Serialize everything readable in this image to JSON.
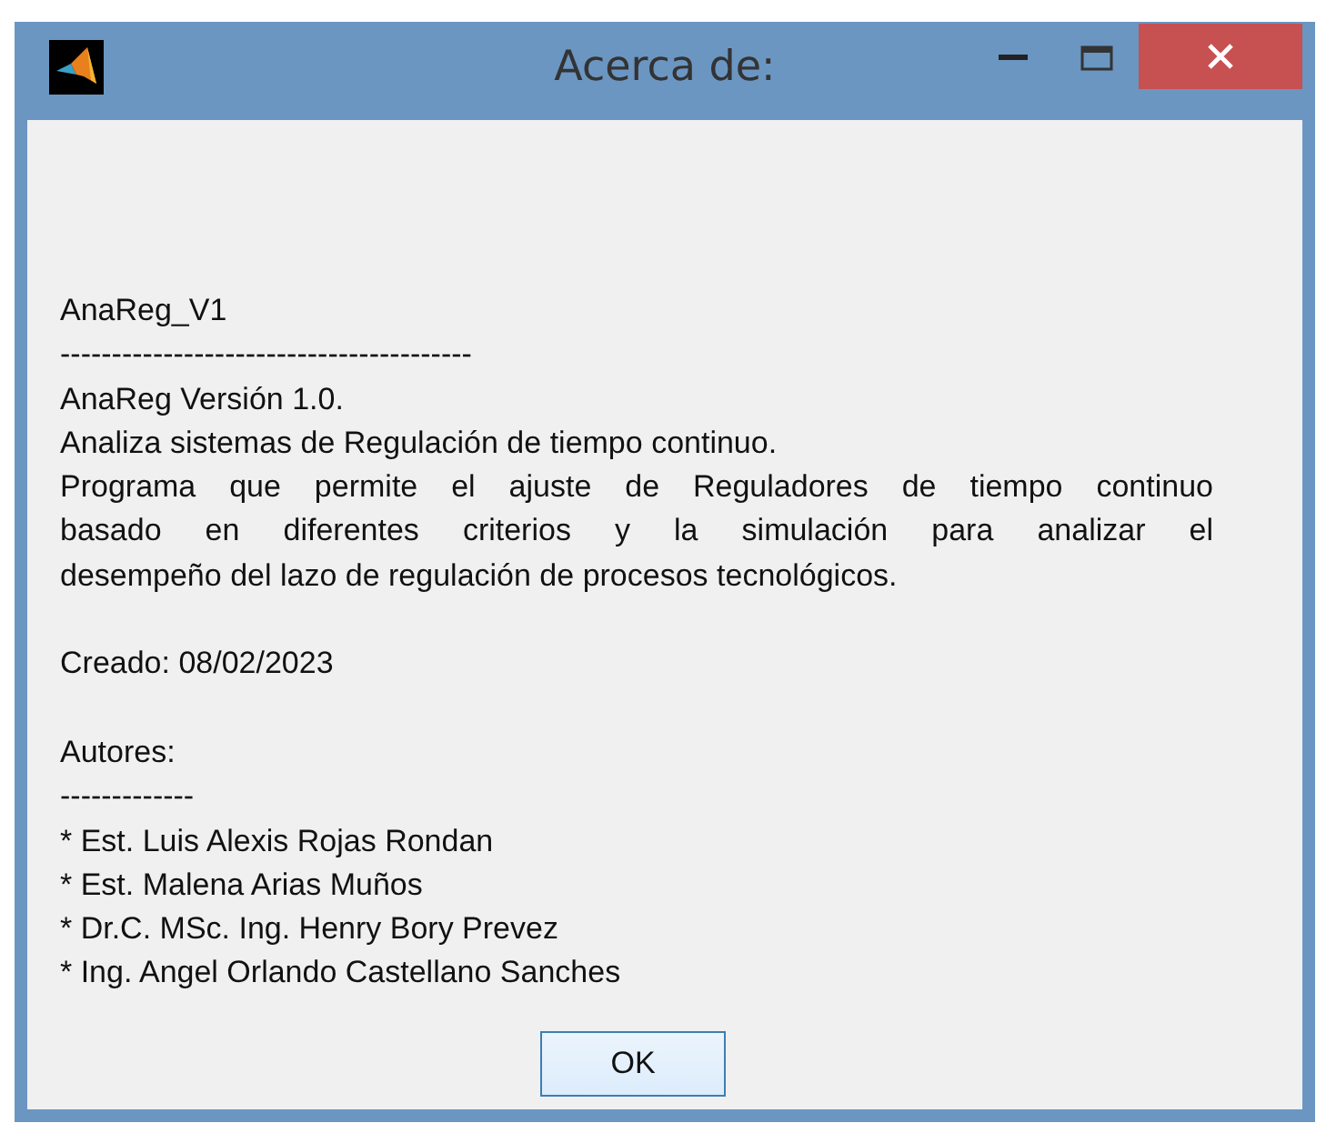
{
  "window": {
    "title": "Acerca de:"
  },
  "paragraphs": [
    [
      {
        "kind": "plain",
        "text": "AnaReg_V1"
      },
      {
        "kind": "plain",
        "text": "----------------------------------------"
      },
      {
        "kind": "plain",
        "text": "AnaReg Versión 1.0."
      },
      {
        "kind": "plain",
        "text": "Analiza sistemas de Regulación de tiempo continuo."
      },
      {
        "kind": "justified",
        "text": "Programa que permite el ajuste de Reguladores de tiempo continuo"
      },
      {
        "kind": "justified",
        "text": "basado  en  diferentes  criterios  y la simulación  para  analizar  el"
      },
      {
        "kind": "plain",
        "text": "desempeño del lazo de regulación de procesos tecnológicos."
      }
    ],
    [
      {
        "kind": "plain",
        "text": "Creado: 08/02/2023"
      }
    ],
    [
      {
        "kind": "plain",
        "text": "Autores:"
      },
      {
        "kind": "plain",
        "text": "-------------"
      },
      {
        "kind": "plain",
        "text": "* Est. Luis Alexis Rojas Rondan"
      },
      {
        "kind": "plain",
        "text": "* Est. Malena Arias Muños"
      },
      {
        "kind": "plain",
        "text": "* Dr.C. MSc. Ing. Henry Bory Prevez"
      },
      {
        "kind": "plain",
        "text": "* Ing. Angel Orlando Castellano Sanches"
      }
    ]
  ],
  "buttons": [
    "OK"
  ]
}
